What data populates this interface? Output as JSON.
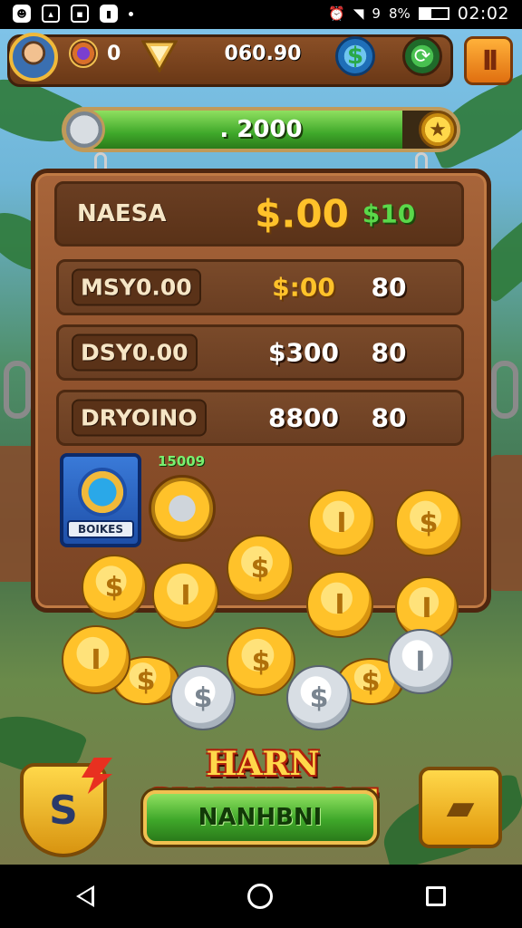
{
  "status_bar": {
    "icons_left": [
      "app-icon",
      "image-icon",
      "square-icon",
      "notification-icon"
    ],
    "alarm_icon": "alarm-icon",
    "signal_text": "9",
    "battery_text": "8%",
    "time": "02:02"
  },
  "hud": {
    "gem_count": "0",
    "score": "060.90",
    "pause_label": "II"
  },
  "progress": {
    "label": ". 2000",
    "fill_fraction": 0.86
  },
  "board": {
    "header": {
      "name": "NAESA",
      "money": "$.00",
      "count": "$10"
    },
    "rows": [
      {
        "name": "MSY0.00",
        "money": "$:00",
        "count": "80"
      },
      {
        "name": "DSY0.00",
        "money": "$300",
        "count": "80"
      },
      {
        "name": "DRYOINO",
        "money": "8800",
        "count": "80"
      }
    ],
    "boost_card_label": "BOIKES",
    "bot_label": "15009"
  },
  "coin_symbols": [
    "$",
    "I",
    "$"
  ],
  "bottom": {
    "title": "HARN SLNIKDKOT",
    "main_button": "NANHBNI",
    "shield_symbol": "S"
  },
  "colors": {
    "wood": "#8a4e2a",
    "gold": "#ffc22a",
    "green": "#3fa82a",
    "money_gold": "#ffc22a",
    "count_green": "#5ad84a"
  }
}
